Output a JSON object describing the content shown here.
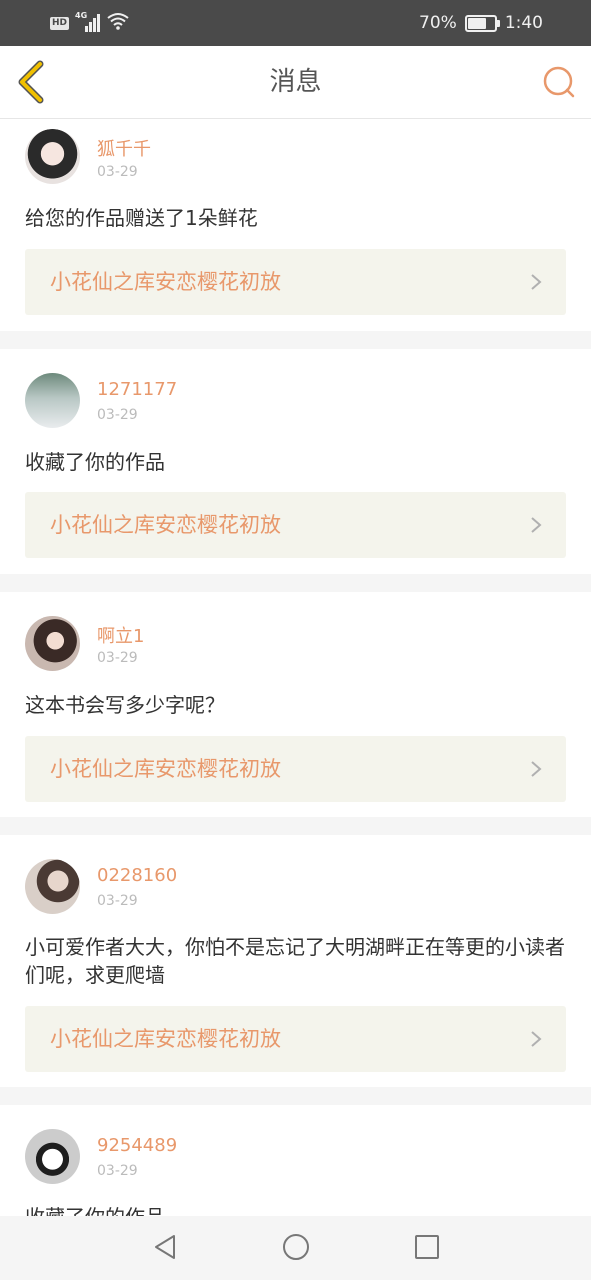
{
  "status_bar": {
    "hd": "HD",
    "network": "4G",
    "battery": "70%",
    "battery_level": 0.7,
    "time": "1:40"
  },
  "nav": {
    "title": "消息",
    "back_icon": "chevron-left-icon",
    "search_icon": "search-icon"
  },
  "colors": {
    "accent": "#e8986b",
    "back_arrow": "#f0c000",
    "link_bg": "#f4f4ec"
  },
  "messages": [
    {
      "user": "狐千千",
      "date": "03-29",
      "text": "给您的作品赠送了1朵鲜花",
      "work": "小花仙之库安恋樱花初放"
    },
    {
      "user": "1271177",
      "date": "03-29",
      "text": "收藏了你的作品",
      "work": "小花仙之库安恋樱花初放"
    },
    {
      "user": "啊立1",
      "date": "03-29",
      "text": "这本书会写多少字呢？",
      "work": "小花仙之库安恋樱花初放"
    },
    {
      "user": "0228160",
      "date": "03-29",
      "text": "小可爱作者大大，你怕不是忘记了大明湖畔正在等更的小读者们呢，求更爬墙",
      "work": "小花仙之库安恋樱花初放"
    },
    {
      "user": "9254489",
      "date": "03-29",
      "text": "收藏了你的作品",
      "work": ""
    }
  ],
  "bottom_nav": {
    "back_icon": "triangle-back-icon",
    "home_icon": "circle-home-icon",
    "recents_icon": "square-recents-icon"
  }
}
